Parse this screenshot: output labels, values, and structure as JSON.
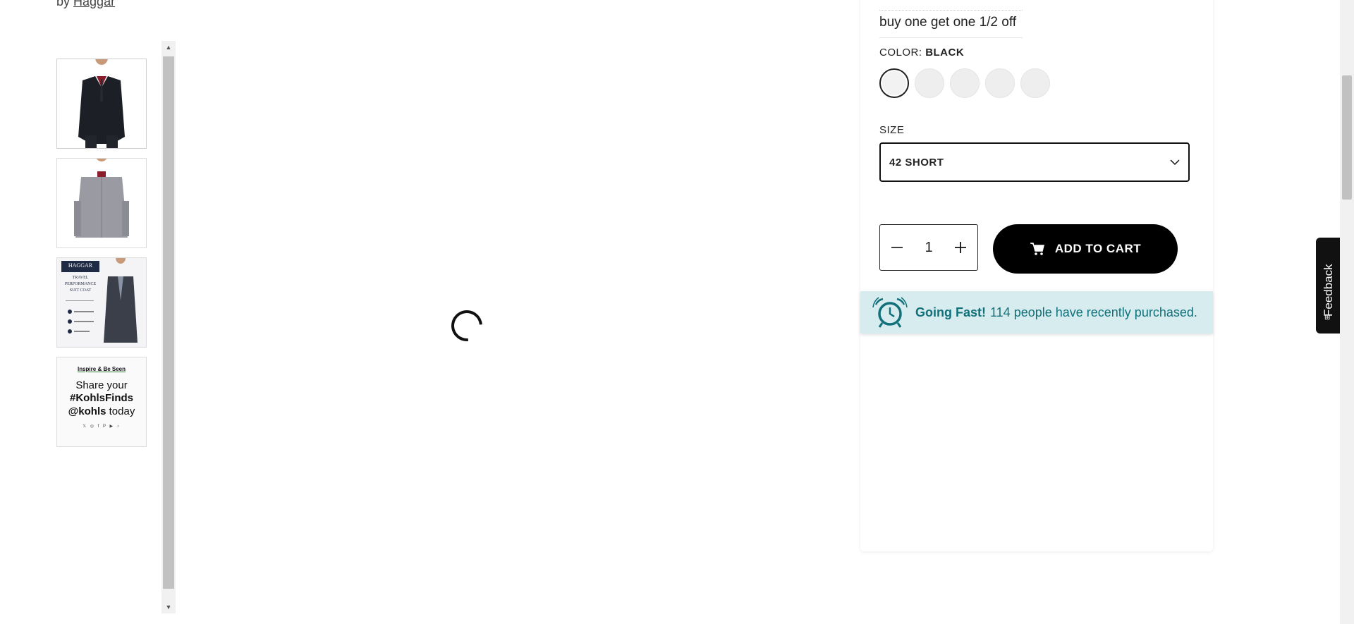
{
  "brand": {
    "prefix": "by",
    "name": "Haggar"
  },
  "thumbnails": [
    {
      "name": "front-view"
    },
    {
      "name": "back-view"
    },
    {
      "name": "feature-card",
      "badge": "HAGGAR",
      "title_lines": [
        "TRAVEL",
        "PERFORMANCE",
        "SUIT COAT"
      ]
    },
    {
      "name": "kohls-promo",
      "eyebrow": "Inspire & Be Seen",
      "line1": "Share your",
      "line2": "#KohlsFinds",
      "line3_bold": "@kohls",
      "line3_rest": " today",
      "socials": "𝕏 ◎ f P ▶ ♪"
    }
  ],
  "product": {
    "promo_text": "buy one get one 1/2 off",
    "color_label": "COLOR:",
    "color_value": "BLACK",
    "swatch_count": 5,
    "size_label": "SIZE",
    "size_value": "42 SHORT",
    "quantity": "1",
    "add_to_cart_label": "ADD TO CART",
    "going_fast_bold": "Going Fast!",
    "going_fast_rest": "114 people have recently purchased."
  },
  "feedback": {
    "label": "Feedback"
  },
  "colors": {
    "accent_teal": "#11707a",
    "banner_bg": "#d7ecee",
    "button_bg": "#000000"
  }
}
